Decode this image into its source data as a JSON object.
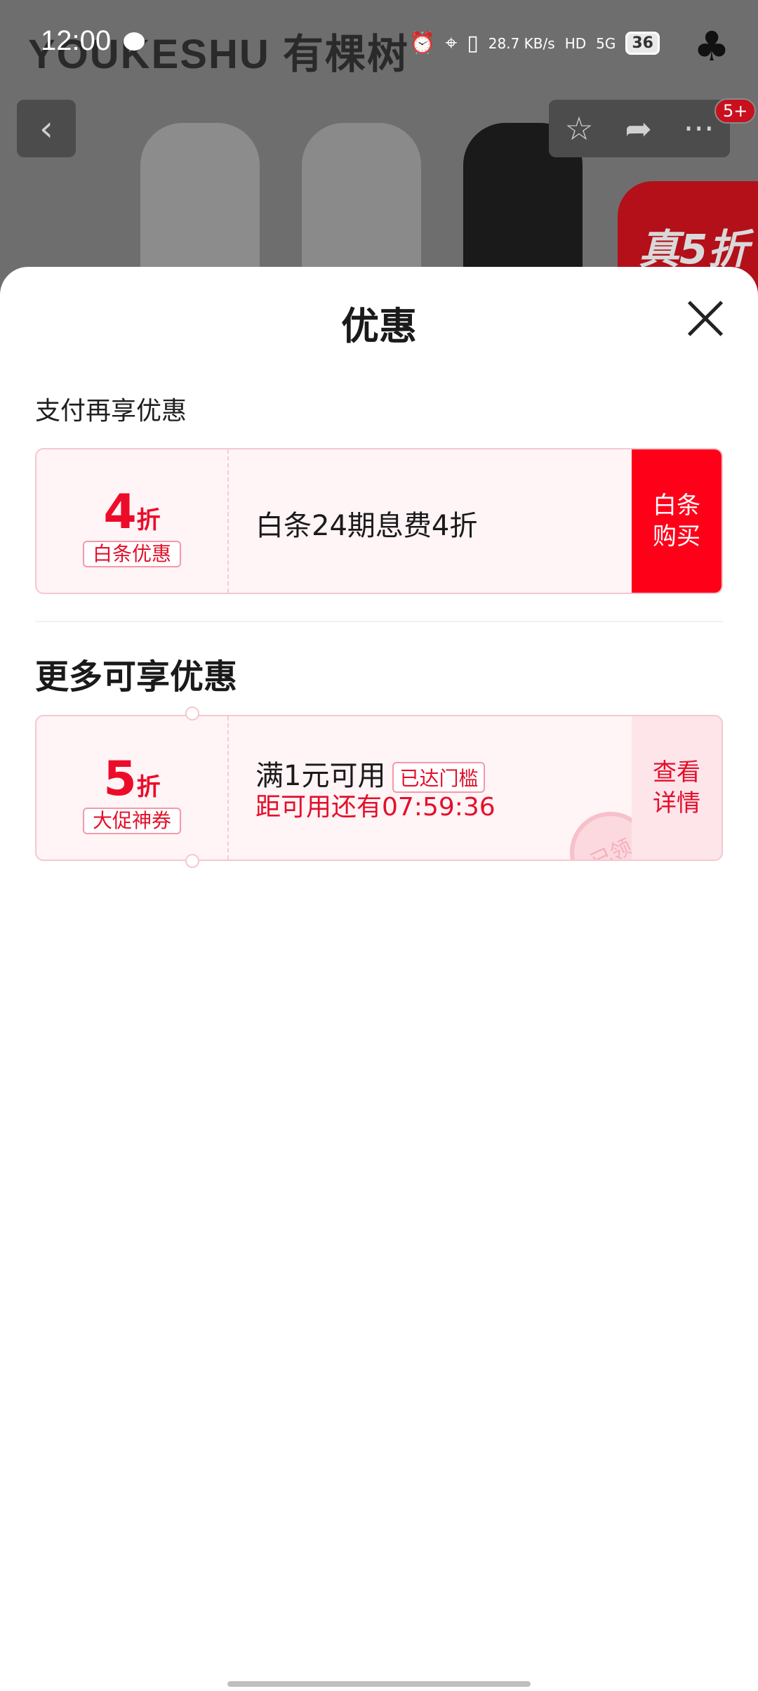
{
  "status_bar": {
    "time": "12:00",
    "network_speed": "28.7 KB/s",
    "hd": "HD",
    "signal": "5G",
    "battery": "36"
  },
  "background": {
    "brand": "YOUKESHU 有棵树",
    "promo_tag": "真5折",
    "cart_badge": "5+"
  },
  "sheet": {
    "title": "优惠",
    "section1_label": "支付再享优惠",
    "card1": {
      "discount_number": "4",
      "discount_unit": "折",
      "tag": "白条优惠",
      "description": "白条24期息费4折",
      "action": "白条购买"
    },
    "section2_title": "更多可享优惠",
    "card2": {
      "discount_number": "5",
      "discount_unit": "折",
      "tag": "大促神券",
      "condition": "满1元可用",
      "reach_tag": "已达门槛",
      "countdown": "距可用还有07:59:36",
      "action": "查看详情",
      "stamp": "已领"
    }
  }
}
